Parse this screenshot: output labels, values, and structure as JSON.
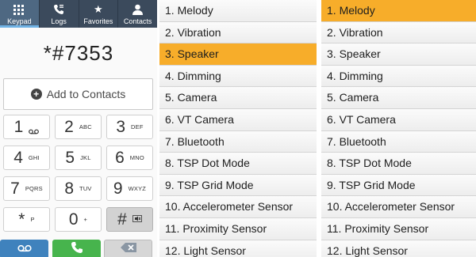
{
  "dialer": {
    "tabs": [
      {
        "label": "Keypad",
        "icon": "keypad-icon",
        "active": true
      },
      {
        "label": "Logs",
        "icon": "call-log-icon",
        "active": false
      },
      {
        "label": "Favorites",
        "icon": "star-icon",
        "active": false
      },
      {
        "label": "Contacts",
        "icon": "person-icon",
        "active": false
      }
    ],
    "number": "*#7353",
    "add_contacts_label": "Add to Contacts",
    "keys": [
      {
        "digit": "1",
        "letters": ""
      },
      {
        "digit": "2",
        "letters": "ABC"
      },
      {
        "digit": "3",
        "letters": "DEF"
      },
      {
        "digit": "4",
        "letters": "GHI"
      },
      {
        "digit": "5",
        "letters": "JKL"
      },
      {
        "digit": "6",
        "letters": "MNO"
      },
      {
        "digit": "7",
        "letters": "PQRS"
      },
      {
        "digit": "8",
        "letters": "TUV"
      },
      {
        "digit": "9",
        "letters": "WXYZ"
      },
      {
        "digit": "*",
        "letters": "P"
      },
      {
        "digit": "0",
        "letters": "+"
      },
      {
        "digit": "#",
        "letters": ""
      }
    ],
    "colors": {
      "tabbar": "#3b4a5c",
      "voicemail": "#3f82bd",
      "call": "#47b44d"
    }
  },
  "menu_middle": {
    "items": [
      "1. Melody",
      "2. Vibration",
      "3. Speaker",
      "4. Dimming",
      "5. Camera",
      "6. VT Camera",
      "7. Bluetooth",
      "8. TSP Dot Mode",
      "9. TSP Grid Mode",
      "10. Accelerometer Sensor",
      "11. Proximity Sensor",
      "12. Light Sensor"
    ],
    "selected_index": 2
  },
  "menu_right": {
    "items": [
      "1. Melody",
      "2. Vibration",
      "3. Speaker",
      "4. Dimming",
      "5. Camera",
      "6. VT Camera",
      "7. Bluetooth",
      "8. TSP Dot Mode",
      "9. TSP Grid Mode",
      "10. Accelerometer Sensor",
      "11. Proximity Sensor",
      "12. Light Sensor"
    ],
    "selected_index": 0
  },
  "highlight_color": "#f7ad2a"
}
